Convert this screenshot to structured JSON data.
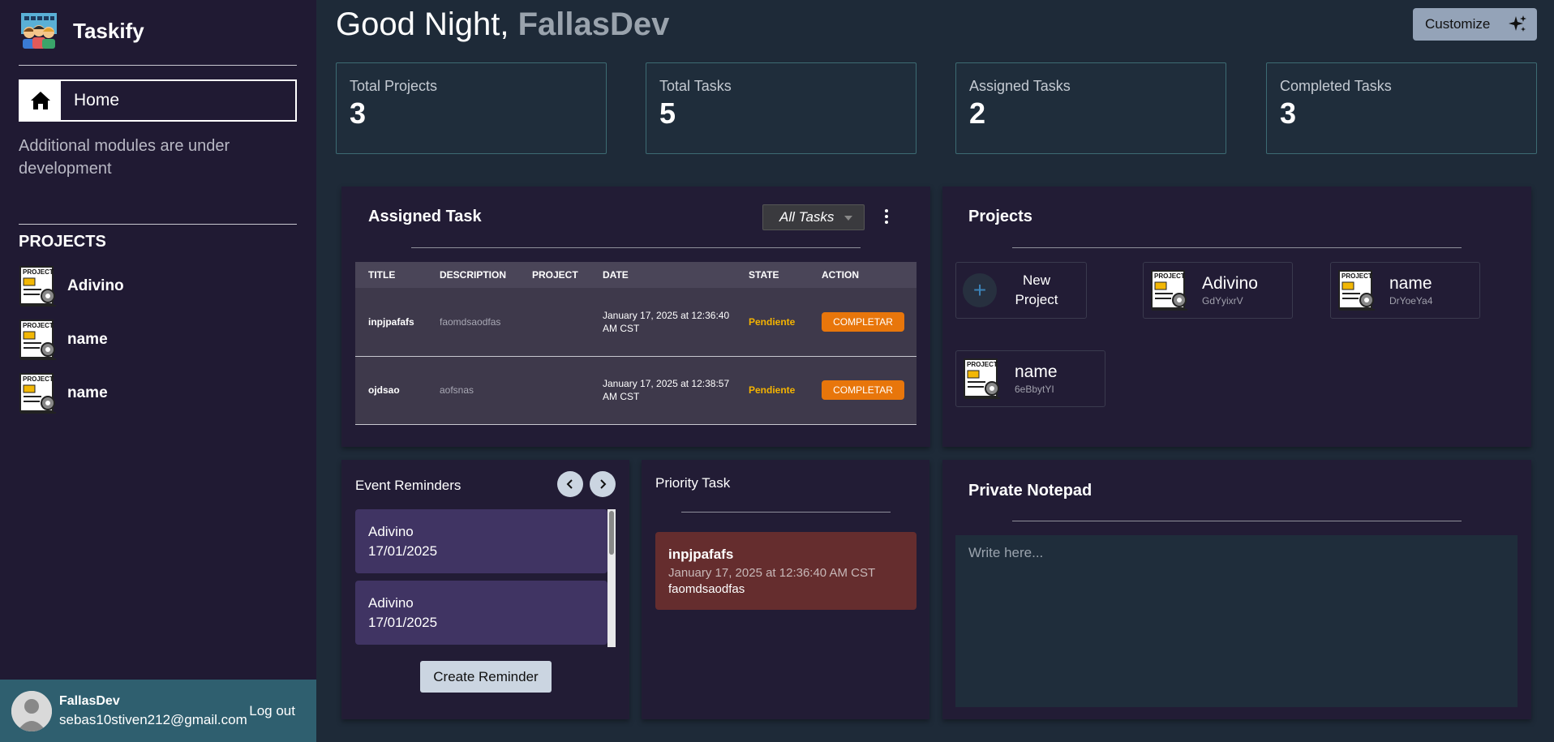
{
  "app": {
    "name": "Taskify"
  },
  "sidebar": {
    "home_label": "Home",
    "dev_note": "Additional modules are under development",
    "projects_heading": "PROJECTS",
    "projects": [
      {
        "label": "Adivino"
      },
      {
        "label": "name"
      },
      {
        "label": "name"
      }
    ]
  },
  "user": {
    "name": "FallasDev",
    "email": "sebas10stiven212@gmail.com",
    "logout_label": "Log out"
  },
  "header": {
    "greeting_prefix": "Good Night,",
    "greeting_name": "FallasDev",
    "customize_label": "Customize"
  },
  "stats": [
    {
      "label": "Total Projects",
      "value": "3"
    },
    {
      "label": "Total Tasks",
      "value": "5"
    },
    {
      "label": "Assigned Tasks",
      "value": "2"
    },
    {
      "label": "Completed Tasks",
      "value": "3"
    }
  ],
  "assigned": {
    "title": "Assigned Task",
    "filter_value": "All Tasks",
    "columns": [
      "TITLE",
      "DESCRIPTION",
      "PROJECT",
      "DATE",
      "STATE",
      "ACTION"
    ],
    "rows": [
      {
        "title": "inpjpafafs",
        "description": "faomdsaodfas",
        "project": "",
        "date": "January 17, 2025 at 12:36:40 AM CST",
        "state": "Pendiente",
        "action": "COMPLETAR"
      },
      {
        "title": "ojdsao",
        "description": "aofsnas",
        "project": "",
        "date": "January 17, 2025 at 12:38:57 AM CST",
        "state": "Pendiente",
        "action": "COMPLETAR"
      }
    ]
  },
  "projects_panel": {
    "title": "Projects",
    "new_label": "New Project",
    "items": [
      {
        "name": "Adivino",
        "code": "GdYyixrV"
      },
      {
        "name": "name",
        "code": "DrYoeYa4"
      },
      {
        "name": "name",
        "code": "6eBbytYI"
      }
    ]
  },
  "reminders": {
    "title": "Event Reminders",
    "items": [
      {
        "name": "Adivino",
        "date": "17/01/2025"
      },
      {
        "name": "Adivino",
        "date": "17/01/2025"
      }
    ],
    "create_label": "Create Reminder"
  },
  "priority": {
    "title": "Priority Task",
    "task": {
      "title": "inpjpafafs",
      "date": "January 17, 2025 at 12:36:40 AM CST",
      "description": "faomdsaodfas"
    }
  },
  "notepad": {
    "title": "Private Notepad",
    "placeholder": "Write here..."
  },
  "colors": {
    "background": "#1e2a38",
    "sidebar": "#201a33",
    "panel": "#221c35",
    "accent_orange": "#e8760b",
    "state_pending": "#f5b400",
    "priority_card": "#652d2e",
    "reminder_card": "#403463",
    "user_bar": "#2f5f6f"
  }
}
